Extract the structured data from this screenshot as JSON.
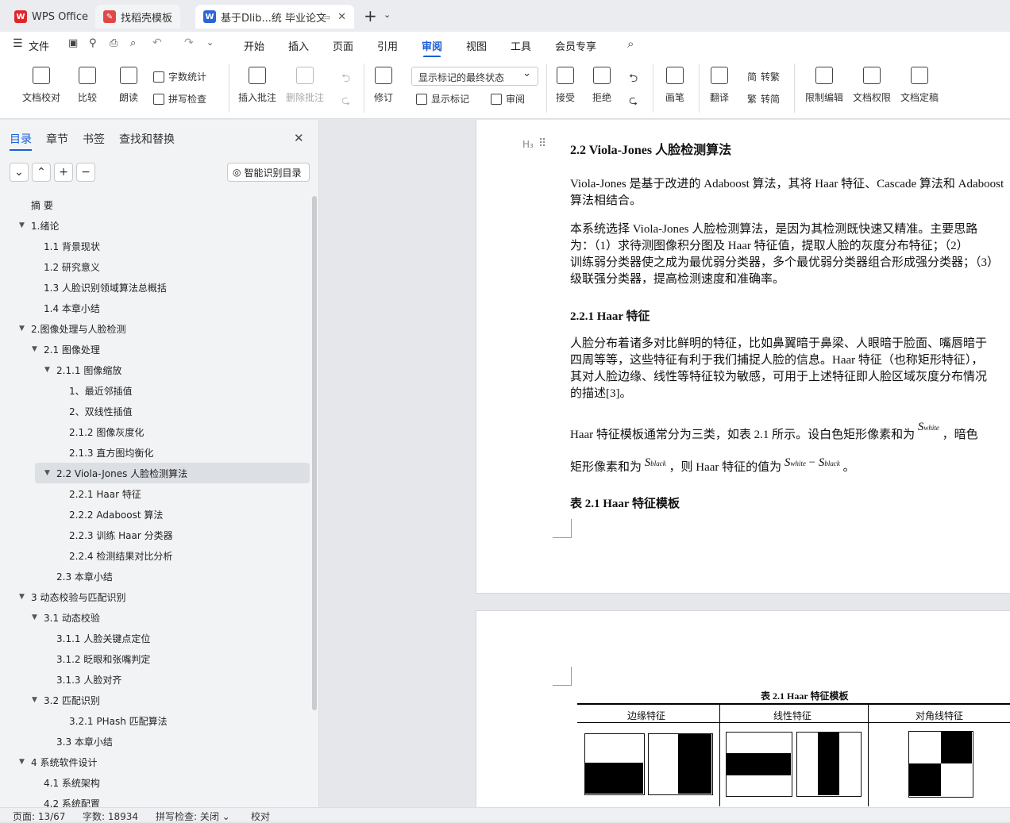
{
  "tabs": [
    {
      "label": "WPS Office",
      "icon": "wps-logo-icon"
    },
    {
      "label": "找稻壳模板",
      "icon": "docer-icon"
    },
    {
      "label": "基于Dlib...统 毕业论文",
      "icon": "word-doc-icon"
    }
  ],
  "menu": {
    "file": "文件",
    "items": [
      "开始",
      "插入",
      "页面",
      "引用",
      "审阅",
      "视图",
      "工具",
      "会员专享"
    ],
    "active": "审阅"
  },
  "ribbon": {
    "proofread": "文档校对",
    "compare": "比较",
    "read_aloud": "朗读",
    "word_count": "字数统计",
    "spell_check": "拼写检查",
    "insert_comment": "插入批注",
    "delete_comment": "删除批注",
    "revise": "修订",
    "display_state": "显示标记的最终状态",
    "show_markup": "显示标记",
    "review": "审阅",
    "accept": "接受",
    "reject": "拒绝",
    "pen": "画笔",
    "translate": "翻译",
    "to_traditional": "转繁",
    "to_simplified": "转简",
    "restrict_edit": "限制编辑",
    "doc_permission": "文档权限",
    "doc_finalize": "文档定稿"
  },
  "sidebar": {
    "tabs": [
      "目录",
      "章节",
      "书签",
      "查找和替换"
    ],
    "smart_btn": "智能识别目录",
    "toc": [
      {
        "label": "摘  要",
        "level": 1,
        "arrow": ""
      },
      {
        "label": "1.绪论",
        "level": 1,
        "arrow": "▼"
      },
      {
        "label": "1.1 背景现状",
        "level": 2,
        "arrow": ""
      },
      {
        "label": "1.2  研究意义",
        "level": 2,
        "arrow": ""
      },
      {
        "label": "1.3 人脸识别领域算法总概括",
        "level": 2,
        "arrow": ""
      },
      {
        "label": "1.4 本章小结",
        "level": 2,
        "arrow": ""
      },
      {
        "label": "2.图像处理与人脸检测",
        "level": 1,
        "arrow": "▼"
      },
      {
        "label": "2.1 图像处理",
        "level": 2,
        "arrow": "▼"
      },
      {
        "label": "2.1.1 图像缩放",
        "level": 3,
        "arrow": "▼"
      },
      {
        "label": "1、最近邻插值",
        "level": 4,
        "arrow": ""
      },
      {
        "label": "2、双线性插值",
        "level": 4,
        "arrow": ""
      },
      {
        "label": "2.1.2 图像灰度化",
        "level": 4,
        "arrow": ""
      },
      {
        "label": "2.1.3 直方图均衡化",
        "level": 4,
        "arrow": ""
      },
      {
        "label": "2.2 Viola-Jones 人脸检测算法",
        "level": 3,
        "arrow": "▼",
        "selected": true
      },
      {
        "label": "2.2.1 Haar 特征",
        "level": 4,
        "arrow": ""
      },
      {
        "label": "2.2.2 Adaboost 算法",
        "level": 4,
        "arrow": ""
      },
      {
        "label": "2.2.3  训练 Haar 分类器",
        "level": 4,
        "arrow": ""
      },
      {
        "label": "2.2.4 检测结果对比分析",
        "level": 4,
        "arrow": ""
      },
      {
        "label": "2.3  本章小结",
        "level": 3,
        "arrow": ""
      },
      {
        "label": "3 动态校验与匹配识别",
        "level": 1,
        "arrow": "▼"
      },
      {
        "label": "3.1  动态校验",
        "level": 2,
        "arrow": "▼"
      },
      {
        "label": "3.1.1 人脸关键点定位",
        "level": 3,
        "arrow": ""
      },
      {
        "label": "3.1.2 眨眼和张嘴判定",
        "level": 3,
        "arrow": ""
      },
      {
        "label": "3.1.3  人脸对齐",
        "level": 3,
        "arrow": ""
      },
      {
        "label": "3.2  匹配识别",
        "level": 2,
        "arrow": "▼"
      },
      {
        "label": "3.2.1 PHash 匹配算法",
        "level": 4,
        "arrow": ""
      },
      {
        "label": "3.3  本章小结",
        "level": 3,
        "arrow": ""
      },
      {
        "label": "4 系统软件设计",
        "level": 1,
        "arrow": "▼"
      },
      {
        "label": "4.1 系统架构",
        "level": 2,
        "arrow": ""
      },
      {
        "label": "4.2 系统配置",
        "level": 2,
        "arrow": ""
      }
    ]
  },
  "doc": {
    "heading_mark": "H₃",
    "h2": "2.2 Viola-Jones 人脸检测算法",
    "p1_l1": "Viola-Jones 是基于改进的 Adaboost 算法，其将 Haar 特征、Cascade 算法和 Adaboost",
    "p1_l2": "算法相结合。",
    "p2_l1": "本系统选择 Viola-Jones 人脸检测算法，是因为其检测既快速又精准。主要思路",
    "p2_l2": "为：（1）求待测图像积分图及 Haar 特征值，提取人脸的灰度分布特征；（2）",
    "p2_l3": "训练弱分类器使之成为最优弱分类器，多个最优弱分类器组合形成强分类器；（3）",
    "p2_l4": "级联强分类器，提高检测速度和准确率。",
    "h3": "2.2.1 Haar 特征",
    "p3_l1": "人脸分布着诸多对比鲜明的特征，比如鼻翼暗于鼻梁、人眼暗于脸面、嘴唇暗于",
    "p3_l2": "四周等等，这些特征有利于我们捕捉人脸的信息。Haar 特征（也称矩形特征），",
    "p3_l3": "其对人脸边缘、线性等特征较为敏感，可用于上述特征即人脸区域灰度分布情况",
    "p3_l4": "的描述[3]。",
    "p4_l1": "Haar 特征模板通常分为三类，如表 2.1 所示。设白色矩形像素和为",
    "p4_sym1": "S",
    "p4_sub1": "white",
    "p4_l1_end": "，暗色",
    "p4_l2": "矩形像素和为",
    "p4_sym2": "S",
    "p4_sub2": "black",
    "p4_l2_mid": "，则 Haar 特征的值为",
    "p4_eq_s1": "S",
    "p4_eq_sub1": "white",
    "p4_eq_minus": " − ",
    "p4_eq_s2": "S",
    "p4_eq_sub2": "black",
    "p4_l2_end": "。",
    "table_caption": "表 2.1 Haar 特征模板",
    "table2_caption": "表 2.1 Haar 特征模板",
    "cols": [
      "边缘特征",
      "线性特征",
      "对角线特征"
    ]
  },
  "status": {
    "page": "页面: 13/67",
    "words": "字数: 18934",
    "spell": "拼写检查: 关闭 ⌄",
    "proof": "校对"
  }
}
